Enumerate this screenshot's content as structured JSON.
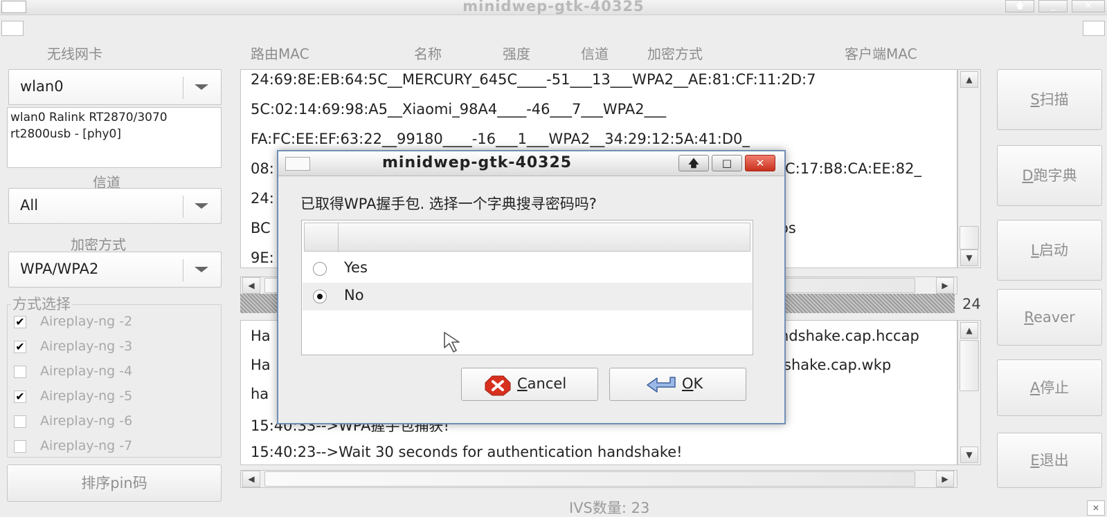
{
  "window": {
    "title": "minidwep-gtk-40325",
    "buttons": [
      "🡅",
      "_",
      "✕"
    ]
  },
  "left": {
    "nic_label": "无线网卡",
    "nic_value": "wlan0",
    "nic_info": "wlan0 Ralink RT2870/3070 rt2800usb - [phy0]",
    "channel_label": "信道",
    "channel_value": "All",
    "encryption_label": "加密方式",
    "encryption_value": "WPA/WPA2",
    "method_label": "方式选择",
    "methods": [
      {
        "label": "Aireplay-ng -2",
        "checked": true
      },
      {
        "label": "Aireplay-ng -3",
        "checked": true
      },
      {
        "label": "Aireplay-ng -4",
        "checked": false
      },
      {
        "label": "Aireplay-ng -5",
        "checked": true
      },
      {
        "label": "Aireplay-ng -6",
        "checked": false
      },
      {
        "label": "Aireplay-ng -7",
        "checked": false
      }
    ],
    "sort_pin_button": "排序pin码"
  },
  "columns": [
    "路由MAC",
    "名称",
    "强度",
    "信道",
    "加密方式",
    "客户端MAC"
  ],
  "ap_list": [
    "24:69:8E:EB:64:5C__MERCURY_645C____-51___13___WPA2__AE:81:CF:11:2D:7",
    "5C:02:14:69:98:A5__Xiaomi_98A4____-46___7___WPA2___",
    "FA:FC:EE:EF:63:22__99180____-16___1___WPA2__34:29:12:5A:41:D0_",
    "08:",
    "24:",
    "BC",
    "9E:"
  ],
  "ap_list_fragments": {
    "row4_tail": "C:17:B8:CA:EE:82_",
    "row6_tail": "os"
  },
  "progress_value": "24",
  "log_list": [
    "Ha",
    "Ha",
    "ha",
    "15:40:33-->WPA握手包捕获!",
    "15:40:23-->Wait 30 seconds for authentication handshake!"
  ],
  "log_fragments": {
    "row1_tail": "ndshake.cap.hccap",
    "row2_tail": "shake.cap.wkp"
  },
  "right_buttons": [
    {
      "key": "S",
      "label": "扫描"
    },
    {
      "key": "D",
      "label": "跑字典"
    },
    {
      "key": "L",
      "label": "启动"
    },
    {
      "key": "R",
      "label": "eaver"
    },
    {
      "key": "A",
      "label": "停止"
    },
    {
      "key": "E",
      "label": "退出"
    }
  ],
  "ivs_label": "IVS数量: 23",
  "dialog": {
    "title": "minidwep-gtk-40325",
    "question": "已取得WPA握手包. 选择一个字典搜寻密码吗?",
    "options": [
      {
        "label": "Yes",
        "selected": false
      },
      {
        "label": "No",
        "selected": true
      }
    ],
    "cancel_key": "C",
    "cancel_rest": "ancel",
    "ok_key": "O",
    "ok_rest": "K"
  }
}
